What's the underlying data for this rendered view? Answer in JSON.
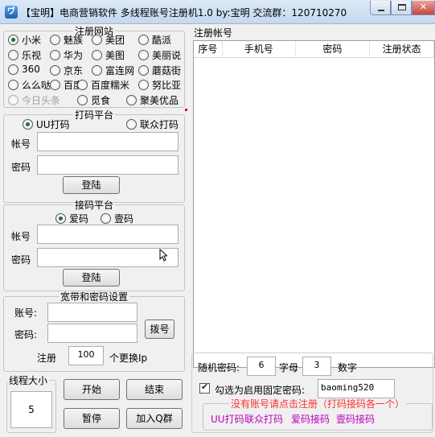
{
  "window": {
    "title": "【宝明】电商营销软件 多线程账号注册机1.0  by:宝明  交流群：120710270",
    "close_glyph": "✕",
    "icon_glyph": "ヷ"
  },
  "sites": {
    "legend": "注册网站",
    "items": [
      "小米",
      "魅族",
      "美团",
      "酷派",
      "乐视",
      "华为",
      "美图",
      "美丽说",
      "360",
      "京东",
      "富连网",
      "蘑菇街",
      "么么哒",
      "百度",
      "百度糯米",
      "努比亚",
      "今日头条",
      "觅食",
      "聚美优品"
    ],
    "selected": "小米",
    "disabled": "今日头条"
  },
  "captcha1": {
    "legend": "打码平台",
    "options": [
      "UU打码",
      "联众打码"
    ],
    "selected": "UU打码",
    "account_label": "帐号",
    "password_label": "密码",
    "account_value": "",
    "password_value": "",
    "login": "登陆"
  },
  "captcha2": {
    "legend": "接码平台",
    "options": [
      "爱码",
      "壹码"
    ],
    "selected": "爱码",
    "account_label": "帐号",
    "password_label": "密码",
    "account_value": "",
    "password_value": "",
    "login": "登陆"
  },
  "broadband": {
    "legend": "宽带和密码设置",
    "account_label": "账号:",
    "password_label": "密码:",
    "account_value": "",
    "password_value": "",
    "dial": "拨号",
    "register_label": "注册",
    "register_count": "100",
    "change_ip_label": "个更换Ip"
  },
  "threads": {
    "legend": "线程大小",
    "value": "5"
  },
  "actions": {
    "start": "开始",
    "end": "结束",
    "pause": "暂停",
    "join": "加入Q群"
  },
  "accounts": {
    "legend": "注册帐号",
    "columns": [
      "序号",
      "手机号",
      "密码",
      "注册状态"
    ],
    "rows": []
  },
  "random_pw": {
    "label": "随机密码:",
    "letters_value": "6",
    "letters_label": "字母",
    "digits_value": "3",
    "digits_label": "数字"
  },
  "fixed_pw": {
    "checked": true,
    "label": "勾选为启用固定密码:",
    "value": "baoming520"
  },
  "links": {
    "notice": "没有账号请点击注册（打码接码各一个）",
    "items": [
      "UU打码",
      "联众打码",
      "爱码接码",
      "壹码接码"
    ]
  }
}
